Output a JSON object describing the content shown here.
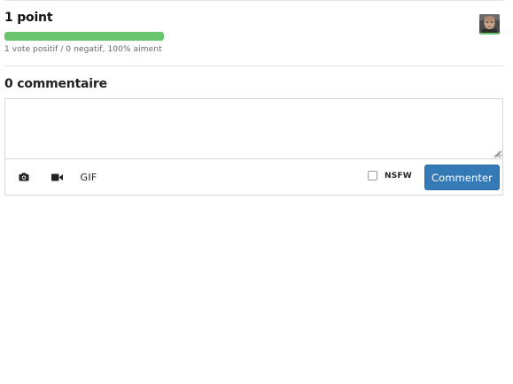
{
  "votes": {
    "points_label": "1 point",
    "summary": "1 vote positif / 0 negatif, 100% aiment",
    "positive_fraction": 1.0,
    "bar_color": "#68c46d",
    "voter_avatar": "user-avatar-photo"
  },
  "comments": {
    "heading": "0 commentaire",
    "textarea_value": "",
    "textarea_placeholder": "",
    "toolbar": {
      "camera_icon": "camera-icon",
      "video_icon": "video-camera-icon",
      "gif_label": "GIF",
      "nsfw_label": "NSFW",
      "nsfw_checked": false,
      "submit_label": "Commenter",
      "submit_color": "#337ab7"
    }
  }
}
